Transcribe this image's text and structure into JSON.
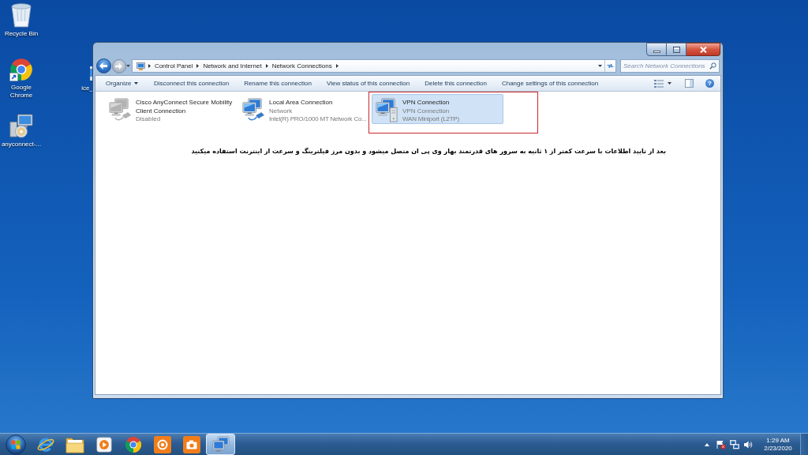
{
  "desktop": {
    "icons": [
      {
        "kind": "recycle-bin",
        "label": "Recycle Bin"
      },
      {
        "kind": "chrome",
        "label": "Google Chrome"
      },
      {
        "kind": "installer",
        "label": "anyconnect-..."
      }
    ],
    "hidden_icon": {
      "label": "ice_"
    }
  },
  "window": {
    "breadcrumb": [
      "Control Panel",
      "Network and Internet",
      "Network Connections"
    ],
    "search": {
      "placeholder": "Search Network Connections"
    },
    "toolbar": [
      {
        "kind": "menu",
        "label": "Organize"
      },
      {
        "kind": "command",
        "label": "Disconnect this connection"
      },
      {
        "kind": "command",
        "label": "Rename this connection"
      },
      {
        "kind": "command",
        "label": "View status of this connection"
      },
      {
        "kind": "command",
        "label": "Delete this connection"
      },
      {
        "kind": "command",
        "label": "Change settings of this connection"
      }
    ],
    "help_label": "?",
    "connections": [
      {
        "kind": "lan",
        "name": "Cisco AnyConnect Secure Mobility Client Connection",
        "status": "Disabled",
        "disabled": true,
        "selected": false,
        "highlighted": false
      },
      {
        "kind": "lan",
        "name": "Local Area Connection",
        "status": "Network",
        "device": "Intel(R) PRO/1000 MT Network Co...",
        "disabled": false,
        "selected": false,
        "highlighted": false
      },
      {
        "kind": "vpn",
        "name": "VPN Connection",
        "status": "VPN Connection",
        "device": "WAN Miniport (L2TP)",
        "disabled": false,
        "selected": true,
        "highlighted": true
      }
    ],
    "caption": "بعد از تایید اطلاعات با سرعت کمتر از ۱ ثانیه به سرور های قدرتمند بهار وی پی ان متصل میشود و بدون مرز فیلترینگ و سرعت از اینترنت استفاده میکنید"
  },
  "taskbar": {
    "apps": [
      {
        "kind": "ie",
        "selected": false
      },
      {
        "kind": "folder",
        "selected": false
      },
      {
        "kind": "media-player",
        "selected": false
      },
      {
        "kind": "chrome",
        "selected": false
      },
      {
        "kind": "record",
        "selected": false
      },
      {
        "kind": "camera",
        "selected": false
      },
      {
        "kind": "network",
        "selected": true
      }
    ],
    "clock": {
      "time": "1:29 AM",
      "date": "2/23/2020"
    }
  }
}
